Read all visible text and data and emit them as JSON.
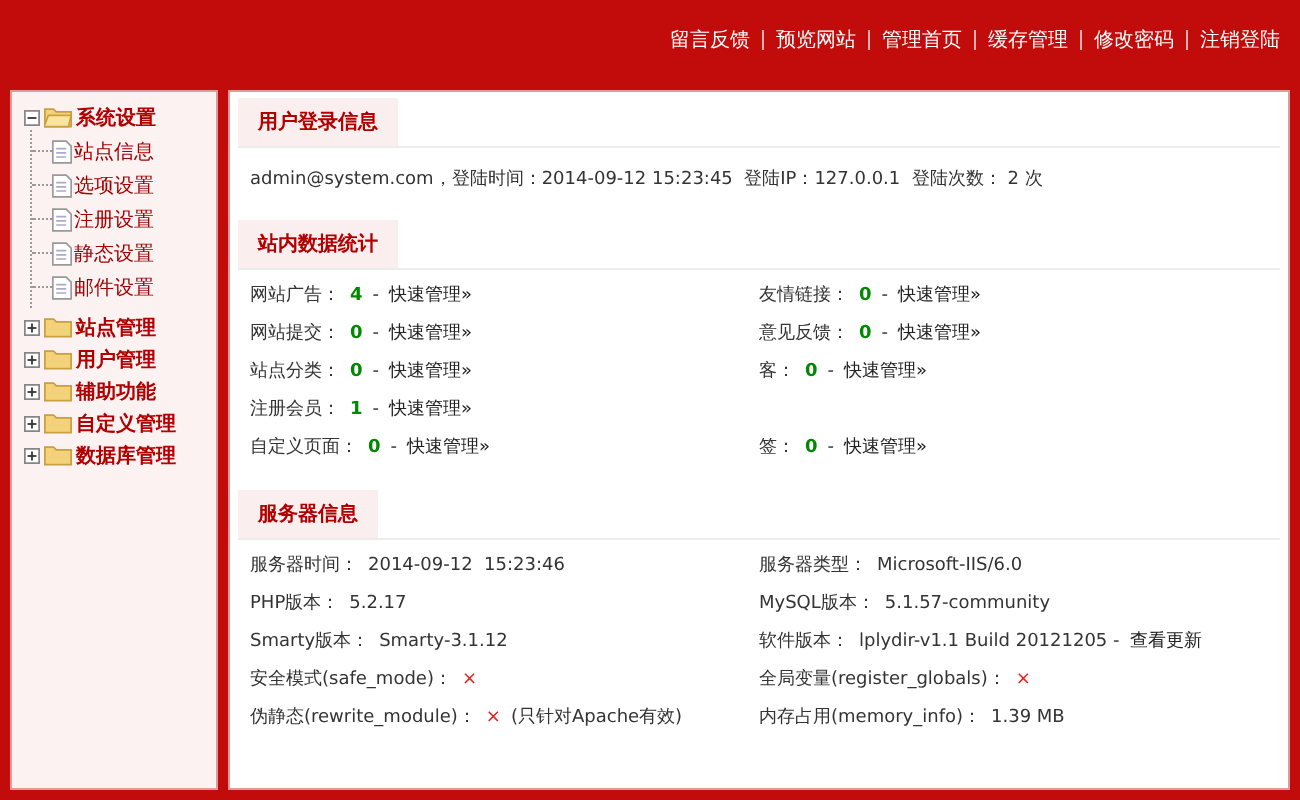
{
  "top_nav": [
    "留言反馈",
    "预览网站",
    "管理首页",
    "缓存管理",
    "修改密码",
    "注销登陆"
  ],
  "sidebar": {
    "items": [
      {
        "label": "系统设置",
        "expanded": true,
        "children": [
          {
            "label": "站点信息"
          },
          {
            "label": "选项设置"
          },
          {
            "label": "注册设置"
          },
          {
            "label": "静态设置"
          },
          {
            "label": "邮件设置"
          }
        ]
      },
      {
        "label": "站点管理",
        "expanded": false
      },
      {
        "label": "用户管理",
        "expanded": false
      },
      {
        "label": "辅助功能",
        "expanded": false
      },
      {
        "label": "自定义管理",
        "expanded": false
      },
      {
        "label": "数据库管理",
        "expanded": false
      }
    ]
  },
  "login_section": {
    "title": "用户登录信息",
    "text": "admin@system.com，登陆时间：2014-09-12 15:23:45  登陆IP：127.0.0.1  登陆次数： 2 次"
  },
  "stats_section": {
    "title": "站内数据统计",
    "rows": [
      {
        "left": {
          "label": "网站广告：",
          "count": "4",
          "dash": "-",
          "link": "快速管理»"
        },
        "right": {
          "label": "友情链接：",
          "count": "0",
          "dash": "-",
          "link": "快速管理»"
        }
      },
      {
        "left": {
          "label": "网站提交：",
          "count": "0",
          "dash": "-",
          "link": "快速管理»"
        },
        "right": {
          "label": "意见反馈：",
          "count": "0",
          "dash": "-",
          "link": "快速管理»"
        }
      },
      {
        "left": {
          "label": "站点分类：",
          "count": "0",
          "dash": "-",
          "link": "快速管理»"
        },
        "right": {
          "label": "客：",
          "count": "0",
          "dash": "-",
          "link": "快速管理»"
        }
      },
      {
        "left": {
          "label": "注册会员：",
          "count": "1",
          "dash": "-",
          "link": "快速管理»"
        }
      },
      {
        "left": {
          "label": "自定义页面：",
          "count": "0",
          "dash": "-",
          "link": "快速管理»"
        },
        "right": {
          "label": "签：",
          "count": "0",
          "dash": "-",
          "link": "快速管理»"
        }
      }
    ]
  },
  "server_section": {
    "title": "服务器信息",
    "rows": [
      {
        "left": {
          "kind": "text",
          "label": "服务器时间：",
          "value": "2014-09-12  15:23:46"
        },
        "right": {
          "kind": "text",
          "label": "服务器类型：",
          "value": "Microsoft-IIS/6.0"
        }
      },
      {
        "left": {
          "kind": "text",
          "label": "PHP版本：",
          "value": "5.2.17"
        },
        "right": {
          "kind": "text",
          "label": "MySQL版本：",
          "value": "5.1.57-community"
        }
      },
      {
        "left": {
          "kind": "text",
          "label": "Smarty版本：",
          "value": "Smarty-3.1.12"
        },
        "right": {
          "kind": "text",
          "label": "软件版本：",
          "value": "lplydir-v1.1 Build 20121205 -",
          "link": "查看更新"
        }
      },
      {
        "left": {
          "kind": "cross",
          "label": "安全模式(safe_mode)：",
          "value": "×"
        },
        "right": {
          "kind": "cross",
          "label": "全局变量(register_globals)：",
          "value": "×"
        }
      },
      {
        "left": {
          "kind": "cross",
          "label": "伪静态(rewrite_module)：",
          "value": "×",
          "note": "(只针对Apache有效)"
        },
        "right": {
          "kind": "text",
          "label": "内存占用(memory_info)：",
          "value": "1.39 MB"
        }
      }
    ]
  }
}
